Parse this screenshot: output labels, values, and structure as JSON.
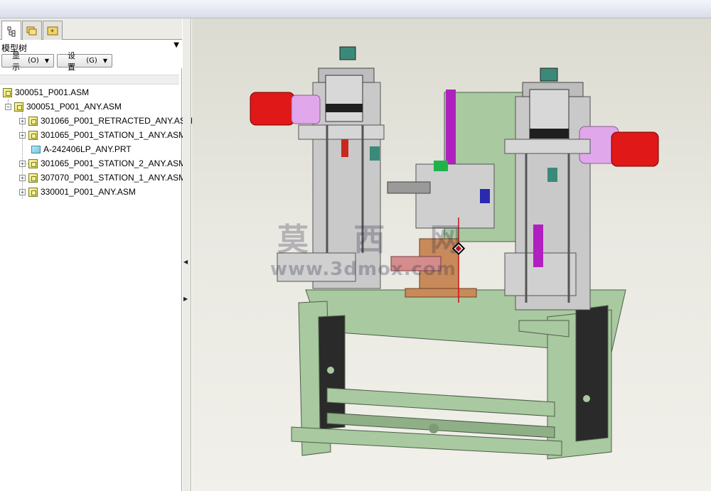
{
  "panel": {
    "title": "模型树",
    "buttons": [
      {
        "label": "显示",
        "shortcut": "(O)"
      },
      {
        "label": "设置",
        "shortcut": "(G)"
      }
    ]
  },
  "tabs": [
    {
      "icon": "model-tree-icon"
    },
    {
      "icon": "folder-browser-icon"
    },
    {
      "icon": "favorites-icon"
    }
  ],
  "tree": {
    "items": [
      {
        "label": "300051_P001.ASM",
        "type": "asm",
        "expander": ""
      },
      {
        "label": "300051_P001_ANY.ASM",
        "type": "asm",
        "expander": "−"
      },
      {
        "label": "301066_P001_RETRACTED_ANY.ASM",
        "type": "asm",
        "expander": "+"
      },
      {
        "label": "301065_P001_STATION_1_ANY.ASM",
        "type": "asm",
        "expander": "+"
      },
      {
        "label": "A-242406LP_ANY.PRT",
        "type": "prt",
        "expander": ""
      },
      {
        "label": "301065_P001_STATION_2_ANY.ASM",
        "type": "asm",
        "expander": "+"
      },
      {
        "label": "307070_P001_STATION_1_ANY.ASM",
        "type": "asm",
        "expander": "+"
      },
      {
        "label": "330001_P001_ANY.ASM",
        "type": "asm",
        "expander": "+"
      }
    ]
  },
  "viewport": {
    "watermark": "莫 西 网",
    "watermark_url": "www.3dmox.com",
    "colors": {
      "frame": "#a9c9a0",
      "motor": "#e01818",
      "motor_coupling": "#e0a8ea",
      "cylinder": "#cfcfcf",
      "accent_teal": "#3a8a7a",
      "accent_purple": "#b020c0",
      "panel_black": "#2a2a2a",
      "copper": "#c88a5a"
    }
  }
}
